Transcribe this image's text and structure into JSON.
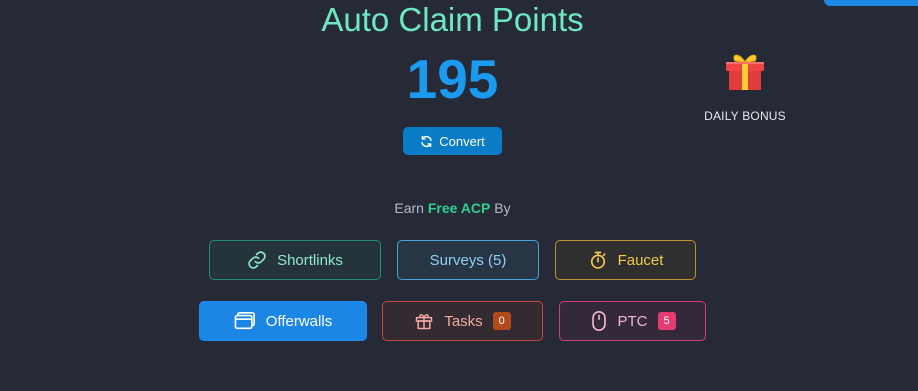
{
  "header": {
    "title": "Auto Claim Points",
    "points": "195",
    "convert_label": "Convert"
  },
  "daily_bonus": {
    "label": "DAILY BONUS",
    "icon": "gift-icon"
  },
  "earn": {
    "prefix": "Earn",
    "highlight": "Free ACP",
    "suffix": "By"
  },
  "options": {
    "shortlinks": {
      "label": "Shortlinks",
      "icon": "link-icon"
    },
    "surveys": {
      "label": "Surveys (5)"
    },
    "faucet": {
      "label": "Faucet",
      "icon": "stopwatch-icon"
    },
    "offerwalls": {
      "label": "Offerwalls",
      "icon": "window-icon"
    },
    "tasks": {
      "label": "Tasks",
      "badge": "0",
      "icon": "gift-icon"
    },
    "ptc": {
      "label": "PTC",
      "badge": "5",
      "icon": "mouse-icon"
    }
  },
  "colors": {
    "background": "#262a37",
    "title": "#6ee7c2",
    "points": "#1a9bf0",
    "accent_green": "#2fd08c",
    "primary_blue": "#1b86e5"
  }
}
